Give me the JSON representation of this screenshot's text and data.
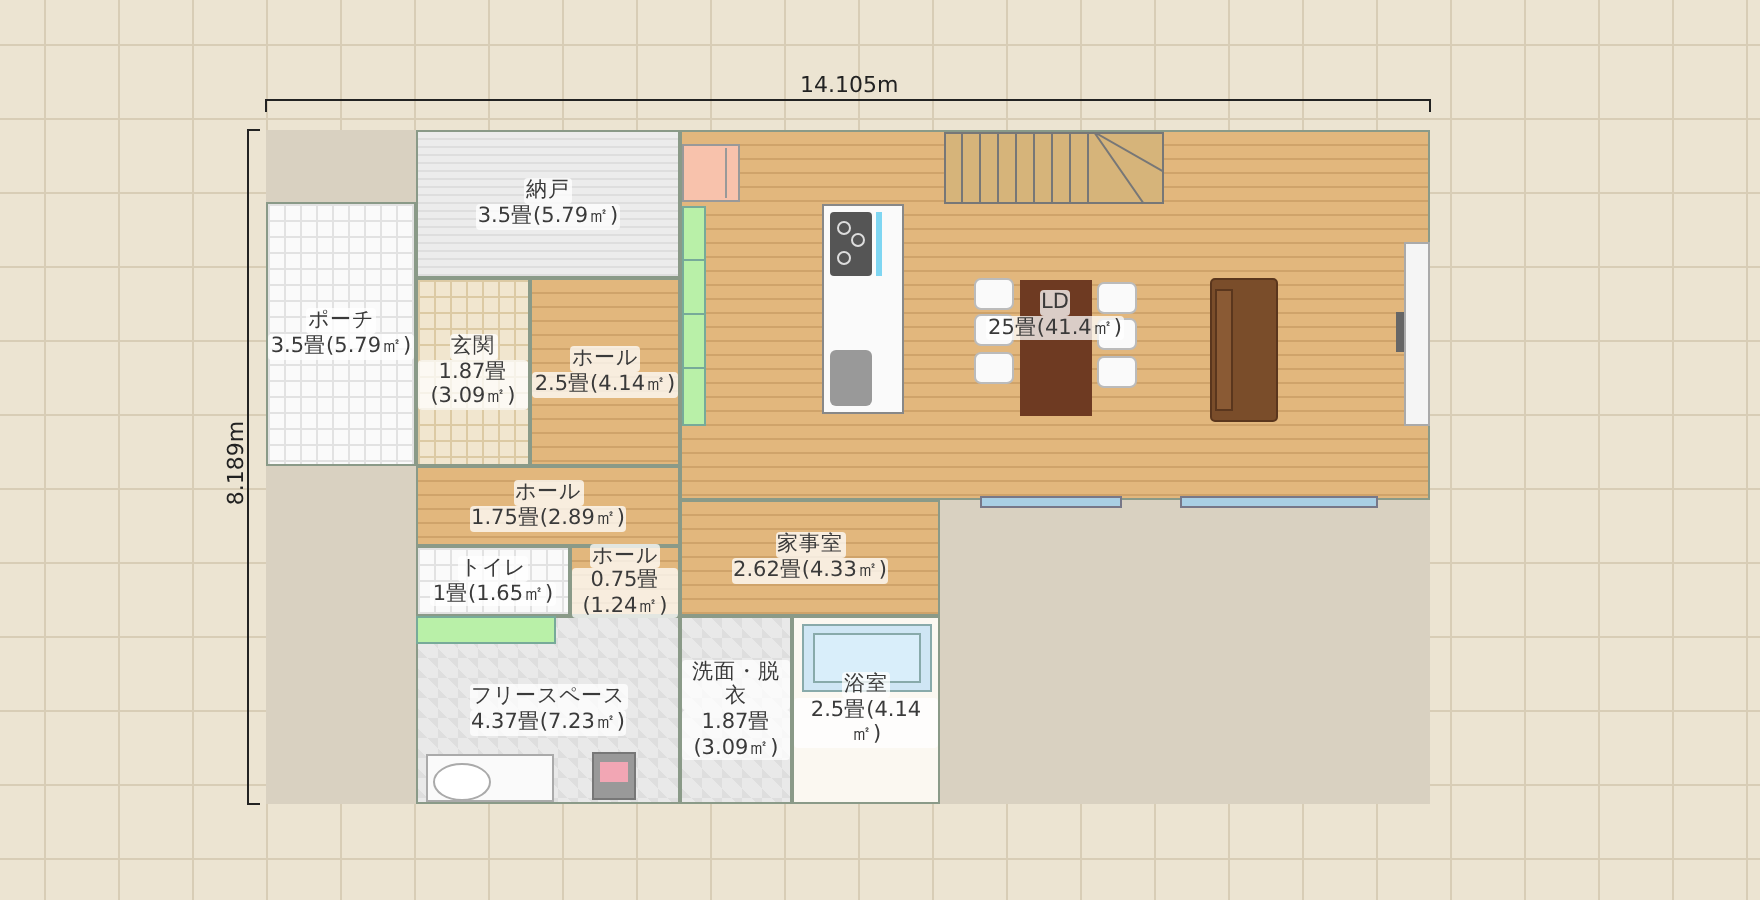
{
  "dimensions": {
    "width": "14.105m",
    "depth": "8.189m"
  },
  "rooms": [
    {
      "name": "納戸",
      "area": "3.5畳(5.79㎡)",
      "kind": "storage"
    },
    {
      "name": "ポーチ",
      "area": "3.5畳(5.79㎡)",
      "kind": "tile"
    },
    {
      "name": "玄関",
      "area": "1.87畳(3.09㎡)",
      "kind": "beige-tile"
    },
    {
      "name": "ホール",
      "area": "2.5畳(4.14㎡)",
      "kind": "wood"
    },
    {
      "name": "LD",
      "area": "25畳(41.4㎡)",
      "kind": "wood"
    },
    {
      "name": "ホール",
      "area": "1.75畳(2.89㎡)",
      "kind": "wood"
    },
    {
      "name": "トイレ",
      "area": "1畳(1.65㎡)",
      "kind": "tile"
    },
    {
      "name": "ホール",
      "area": "0.75畳(1.24㎡)",
      "kind": "wood"
    },
    {
      "name": "家事室",
      "area": "2.62畳(4.33㎡)",
      "kind": "wood"
    },
    {
      "name": "フリースペース",
      "area": "4.37畳(7.23㎡)",
      "kind": "grey-tile"
    },
    {
      "name": "洗面・脱衣",
      "area": "1.87畳(3.09㎡)",
      "kind": "grey-tile"
    },
    {
      "name": "浴室",
      "area": "2.5畳(4.14㎡)",
      "kind": "bath"
    }
  ]
}
